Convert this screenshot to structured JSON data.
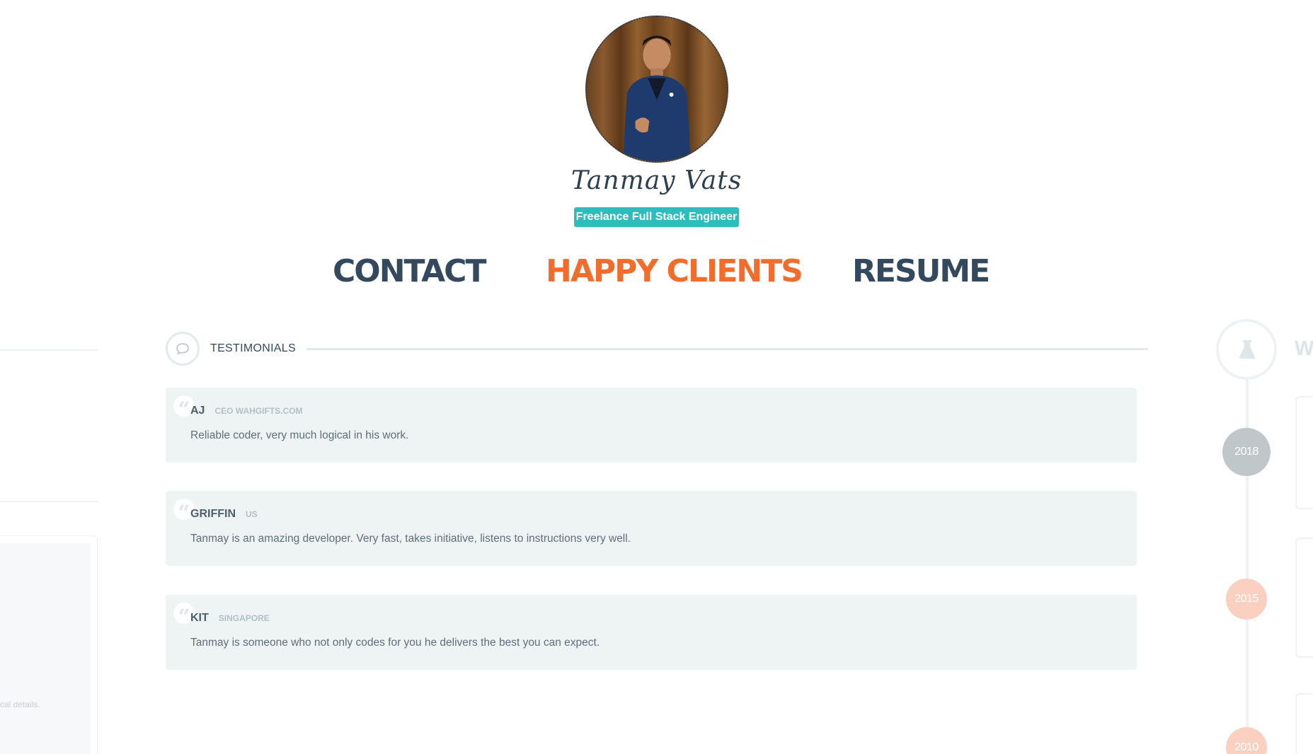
{
  "profile": {
    "name": "Tanmay Vats",
    "role": "Freelance Full Stack Engineer"
  },
  "nav": {
    "items": [
      {
        "label": "CONTACT",
        "active": false
      },
      {
        "label": "HAPPY CLIENTS",
        "active": true
      },
      {
        "label": "RESUME",
        "active": false
      }
    ],
    "active_color": "#f36c2c",
    "default_color": "#34495e"
  },
  "section": {
    "title": "TESTIMONIALS",
    "icon": "chat-bubble-icon"
  },
  "testimonials": [
    {
      "name": "AJ",
      "meta": "CEO WAHGIFTS.COM",
      "text": "Reliable coder, very much logical in his work."
    },
    {
      "name": "GRIFFIN",
      "meta": "US",
      "text": "Tanmay is an amazing developer. Very fast, takes initiative, listens to instructions very well."
    },
    {
      "name": "KIT",
      "meta": "SINGAPORE",
      "text": "Tanmay is someone who not only codes for you he delivers the best you can expect."
    }
  ],
  "left_panel": {
    "text_fragment": "cal details."
  },
  "timeline": {
    "icon": "flask-icon",
    "heading_fragment": "W",
    "years": [
      "2018",
      "2015",
      "2010"
    ]
  },
  "colors": {
    "accent": "#2ebdbd",
    "highlight": "#f36c2c",
    "card_bg": "#eef3f4"
  }
}
